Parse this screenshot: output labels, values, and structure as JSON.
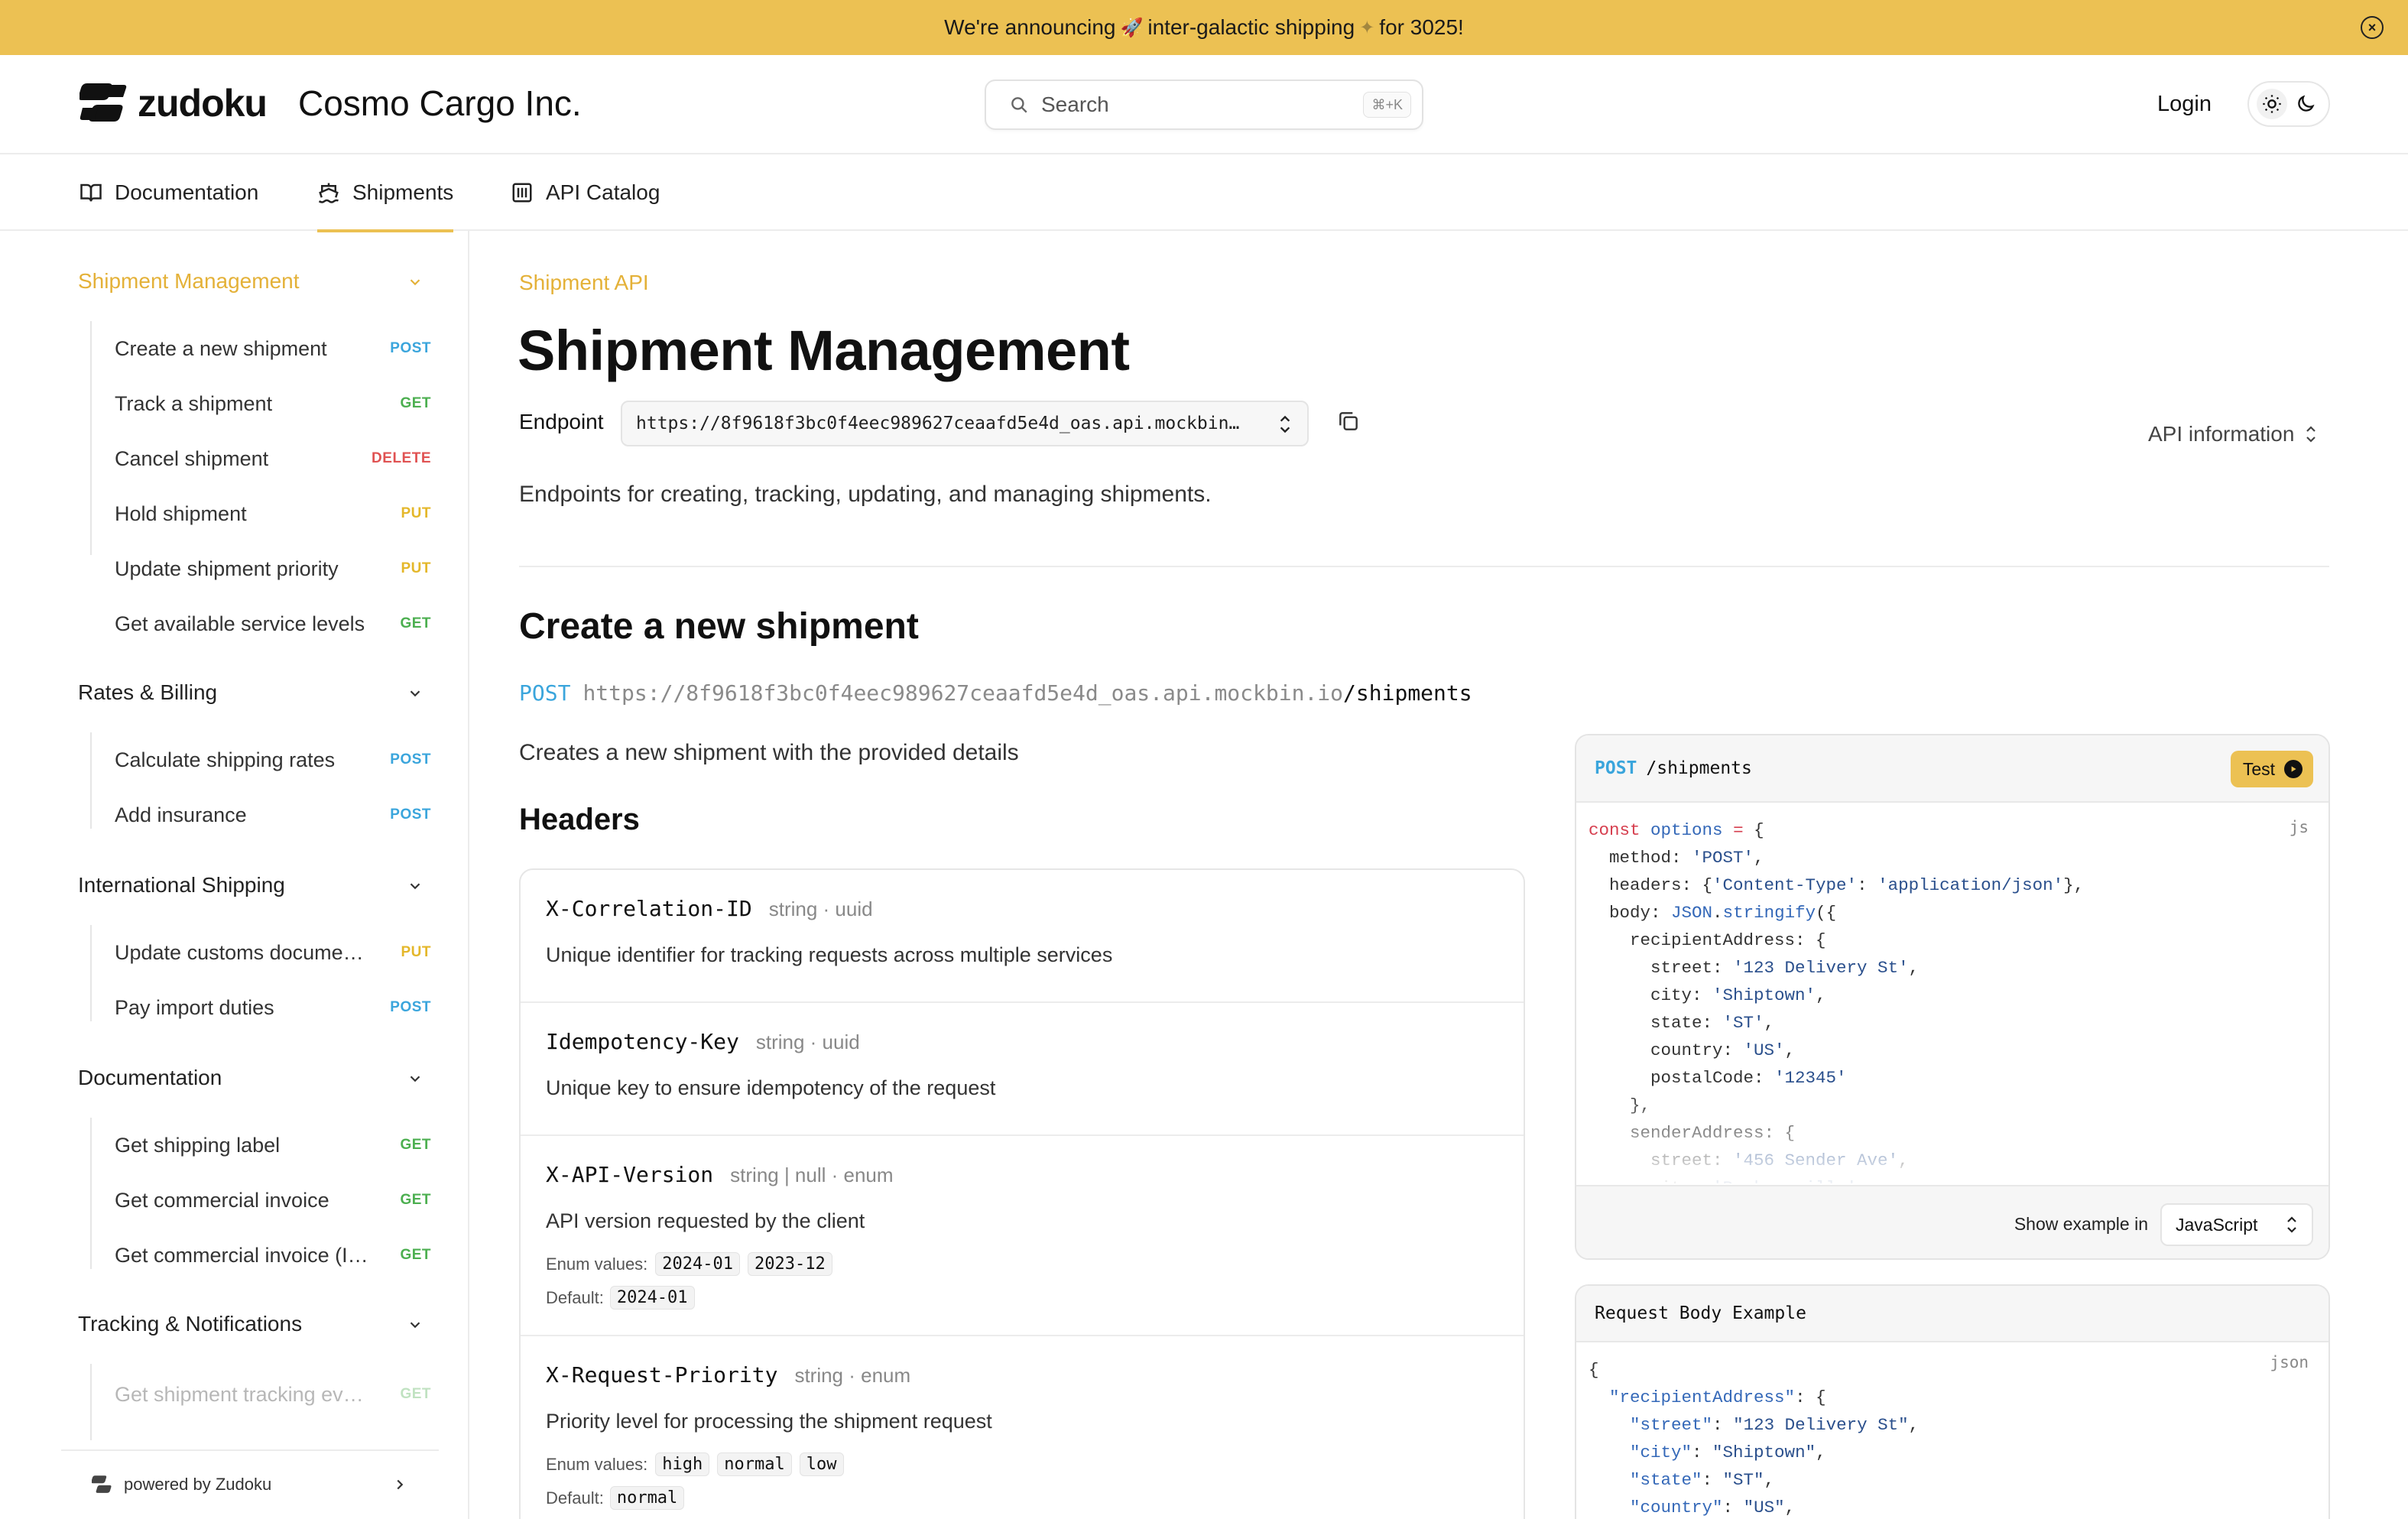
{
  "banner": {
    "text_before": "We're announcing",
    "text_highlight": "inter-galactic shipping",
    "text_after": "for 3025!"
  },
  "header": {
    "logo_word": "zudoku",
    "site_title": "Cosmo Cargo Inc.",
    "search_placeholder": "Search",
    "search_shortcut": "⌘+K",
    "login_label": "Login"
  },
  "tabs": [
    {
      "label": "Documentation",
      "icon": "book-icon"
    },
    {
      "label": "Shipments",
      "icon": "ship-icon",
      "active": true
    },
    {
      "label": "API Catalog",
      "icon": "catalog-icon"
    }
  ],
  "sidebar": {
    "groups": [
      {
        "title": "Shipment Management",
        "active": true,
        "items": [
          {
            "label": "Create a new shipment",
            "method": "POST"
          },
          {
            "label": "Track a shipment",
            "method": "GET"
          },
          {
            "label": "Cancel shipment",
            "method": "DELETE"
          },
          {
            "label": "Hold shipment",
            "method": "PUT"
          },
          {
            "label": "Update shipment priority",
            "method": "PUT"
          },
          {
            "label": "Get available service levels",
            "method": "GET"
          }
        ]
      },
      {
        "title": "Rates & Billing",
        "items": [
          {
            "label": "Calculate shipping rates",
            "method": "POST"
          },
          {
            "label": "Add insurance",
            "method": "POST"
          }
        ]
      },
      {
        "title": "International Shipping",
        "items": [
          {
            "label": "Update customs docume…",
            "method": "PUT"
          },
          {
            "label": "Pay import duties",
            "method": "POST"
          }
        ]
      },
      {
        "title": "Documentation",
        "items": [
          {
            "label": "Get shipping label",
            "method": "GET"
          },
          {
            "label": "Get commercial invoice",
            "method": "GET"
          },
          {
            "label": "Get commercial invoice (I…",
            "method": "GET"
          }
        ]
      },
      {
        "title": "Tracking & Notifications",
        "items": [
          {
            "label": "Get shipment tracking ev…",
            "method": "GET"
          }
        ]
      }
    ],
    "footer": "powered by Zudoku"
  },
  "main": {
    "breadcrumb": "Shipment API",
    "title": "Shipment Management",
    "endpoint_label": "Endpoint",
    "endpoint_url": "https://8f9618f3bc0f4eec989627ceaafd5e4d_oas.api.mockbin…",
    "api_info": "API information",
    "description": "Endpoints for creating, tracking, updating, and managing shipments.",
    "operation": {
      "title": "Create a new shipment",
      "method": "POST",
      "base_url": "https://8f9618f3bc0f4eec989627ceaafd5e4d_oas.api.mockbin.io",
      "path": "/shipments",
      "description": "Creates a new shipment with the provided details",
      "headers_title": "Headers",
      "params": [
        {
          "name": "X-Correlation-ID",
          "type": "string · uuid",
          "desc": "Unique identifier for tracking requests across multiple services"
        },
        {
          "name": "Idempotency-Key",
          "type": "string · uuid",
          "desc": "Unique key to ensure idempotency of the request"
        },
        {
          "name": "X-API-Version",
          "type": "string | null · enum",
          "desc": "API version requested by the client",
          "enum_label": "Enum values:",
          "enum": [
            "2024-01",
            "2023-12"
          ],
          "default_label": "Default:",
          "default": "2024-01"
        },
        {
          "name": "X-Request-Priority",
          "type": "string · enum",
          "desc": "Priority level for processing the shipment request",
          "enum_label": "Enum values:",
          "enum": [
            "high",
            "normal",
            "low"
          ],
          "default_label": "Default:",
          "default": "normal"
        }
      ]
    }
  },
  "code_panel": {
    "method": "POST",
    "path": "/shipments",
    "test_label": "Test",
    "lang_tag": "js",
    "show_example_label": "Show example in",
    "language": "JavaScript"
  },
  "body_panel": {
    "title": "Request Body Example",
    "lang_tag": "json"
  },
  "colors": {
    "accent": "#ECC153",
    "post": "#3AA5DC",
    "get": "#4CAF50",
    "delete": "#E05252",
    "put": "#E4B72A"
  }
}
